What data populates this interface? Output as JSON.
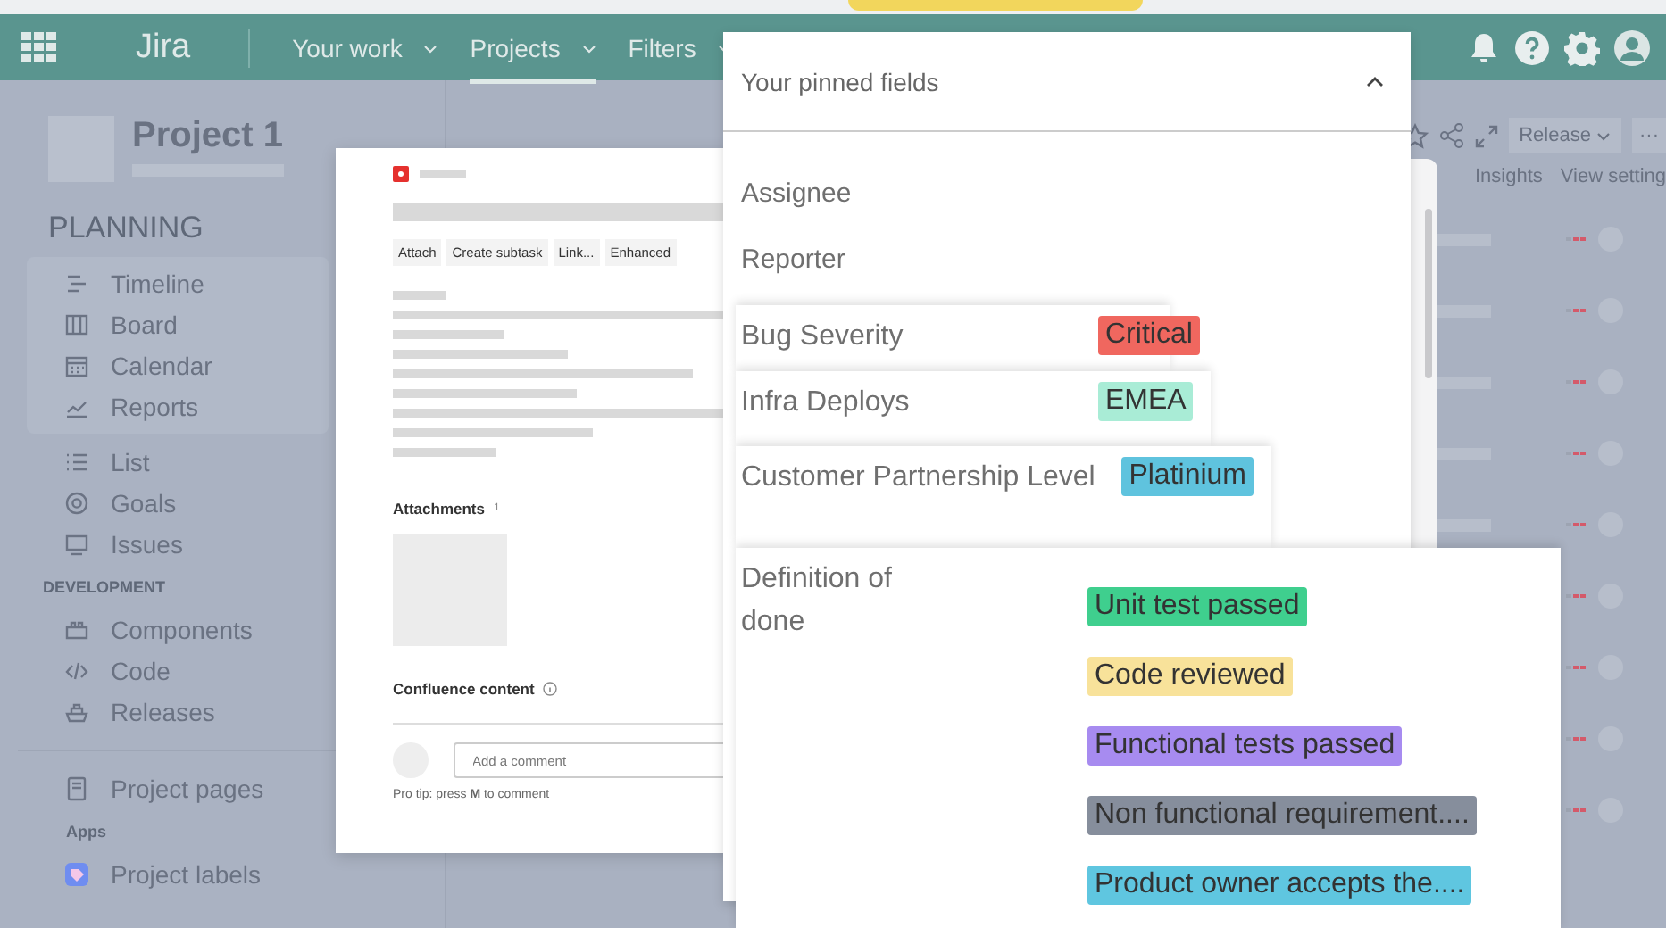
{
  "top_nav": {
    "product": "Jira",
    "tabs": [
      {
        "label": "Your work",
        "selected": false
      },
      {
        "label": "Projects",
        "selected": true
      },
      {
        "label": "Filters",
        "selected": false
      }
    ]
  },
  "sidebar": {
    "project_name": "Project 1",
    "sections": [
      {
        "heading": "PLANNING",
        "kind": "large",
        "items": [
          "Timeline",
          "Board",
          "Calendar",
          "Reports"
        ]
      },
      {
        "kind": "plain",
        "items": [
          "List",
          "Goals",
          "Issues"
        ]
      },
      {
        "heading": "DEVELOPMENT",
        "kind": "small",
        "items": [
          "Components",
          "Code",
          "Releases"
        ]
      },
      {
        "kind": "plain",
        "items": [
          "Project pages"
        ]
      },
      {
        "heading": "Apps",
        "kind": "small",
        "items": [
          "Project labels"
        ]
      }
    ]
  },
  "board_toolbar": {
    "release_button": "Release",
    "more_button": "···",
    "insights": "Insights",
    "view_settings": "View setting"
  },
  "issue_modal": {
    "actions": [
      "Attach",
      "Create subtask",
      "Link...",
      "Enhanced"
    ],
    "attachments_label": "Attachments",
    "attachments_count": "1",
    "confluence_label": "Confluence content",
    "comment": {
      "placeholder": "Add a comment"
    },
    "tip": "Pro tip: press **M** to comment"
  },
  "pinned_fields": {
    "title": "Your pinned fields",
    "expanded": true,
    "fields": [
      {
        "label": "Assignee",
        "kind": "plain"
      },
      {
        "label": "Reporter",
        "kind": "plain"
      },
      {
        "label": "Bug Severity",
        "kind": "card",
        "tags": [
          {
            "text": "Critical",
            "color": "#f0675f"
          }
        ]
      },
      {
        "label": "Infra Deploys",
        "kind": "card",
        "tags": [
          {
            "text": "EMEA",
            "color": "#a9ecd6"
          }
        ]
      },
      {
        "label": "Customer Partnership Level",
        "kind": "card",
        "tags": [
          {
            "text": "Platinium",
            "color": "#5fc3de"
          }
        ]
      },
      {
        "label": "Definition of done",
        "kind": "card",
        "tags": [
          {
            "text": "Unit test passed",
            "color": "#3fcf8e"
          },
          {
            "text": "Code reviewed",
            "color": "#f8e29a"
          },
          {
            "text": "Functional tests passed",
            "color": "#a78bf0"
          },
          {
            "text": "Non functional requirement....",
            "color": "#868e9c"
          },
          {
            "text": "Product owner accepts the....",
            "color": "#5fc6e0"
          }
        ]
      }
    ]
  }
}
